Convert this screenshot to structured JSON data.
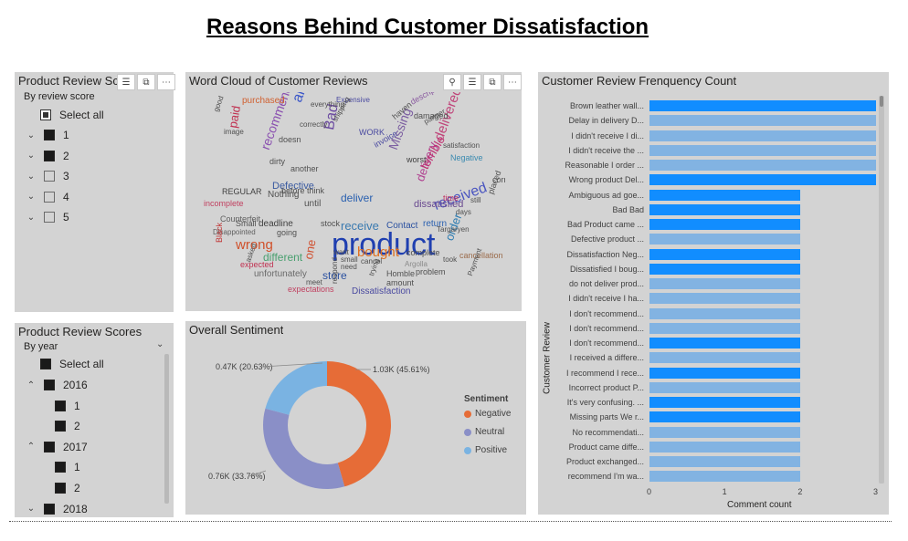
{
  "page": {
    "title": "Reasons Behind Customer Dissatisfaction"
  },
  "colors": {
    "panel_bg": "#d3d3d3",
    "bar_dark": "#118dff",
    "bar_light": "#82b3e2",
    "negative": "#e66c37",
    "neutral": "#8a8fc7",
    "positive": "#7ab3e2"
  },
  "slicer1": {
    "title": "Product Review Scores",
    "subtitle": "By review score",
    "select_all": "Select all",
    "items": [
      {
        "label": "1",
        "checked": true
      },
      {
        "label": "2",
        "checked": true
      },
      {
        "label": "3",
        "checked": false
      },
      {
        "label": "4",
        "checked": false
      },
      {
        "label": "5",
        "checked": false
      }
    ],
    "icons": [
      "filter-icon",
      "focus-mode-icon",
      "more-options-icon"
    ]
  },
  "slicer2": {
    "title": "Product Review Scores",
    "subtitle": "By year",
    "select_all": "Select all",
    "rows": [
      {
        "label": "2016",
        "level": 0,
        "expanded": true
      },
      {
        "label": "1",
        "level": 1
      },
      {
        "label": "2",
        "level": 1
      },
      {
        "label": "2017",
        "level": 0,
        "expanded": true
      },
      {
        "label": "1",
        "level": 1
      },
      {
        "label": "2",
        "level": 1
      },
      {
        "label": "2018",
        "level": 0,
        "expanded": false
      }
    ]
  },
  "wordcloud": {
    "title": "Word Cloud of Customer Reviews",
    "icons": [
      "pin-icon",
      "filter-icon",
      "focus-mode-icon",
      "more-options-icon"
    ],
    "words": [
      {
        "text": "product",
        "color": "#1f3fb0"
      },
      {
        "text": "received",
        "color": "#4a55c0"
      },
      {
        "text": "delivered",
        "color": "#c0457a"
      },
      {
        "text": "arrived",
        "color": "#3a56c8"
      },
      {
        "text": "Missing",
        "color": "#7a5ca0"
      },
      {
        "text": "bought",
        "color": "#e07020"
      },
      {
        "text": "wrong",
        "color": "#d0502a"
      },
      {
        "text": "recommend",
        "color": "#8a4fb0"
      },
      {
        "text": "delivery",
        "color": "#b04090"
      },
      {
        "text": "terrible",
        "color": "#c03070"
      },
      {
        "text": "Bad",
        "color": "#6b4aa0"
      },
      {
        "text": "receive",
        "color": "#3a7ab0"
      },
      {
        "text": "paid",
        "color": "#c03050"
      },
      {
        "text": "order",
        "color": "#2a7ab0"
      },
      {
        "text": "one",
        "color": "#d05030"
      },
      {
        "text": "different",
        "color": "#4aa070"
      },
      {
        "text": "store",
        "color": "#2a50a0"
      },
      {
        "text": "Defective",
        "color": "#3a5aa0"
      },
      {
        "text": "dissatisfied",
        "color": "#6a4a90"
      },
      {
        "text": "deliver",
        "color": "#2a60b0"
      },
      {
        "text": "unfortunately",
        "color": "#6a6a6a"
      },
      {
        "text": "Expensive",
        "color": "#4a4aa0"
      },
      {
        "text": "damaged",
        "color": "#505050"
      },
      {
        "text": "purchased",
        "color": "#d06030"
      },
      {
        "text": "cancellation",
        "color": "#9a6a4a"
      },
      {
        "text": "WORK",
        "color": "#4a4aa0"
      },
      {
        "text": "Negative",
        "color": "#3a8ab0"
      },
      {
        "text": "satisfaction",
        "color": "#505050"
      },
      {
        "text": "complete",
        "color": "#505050"
      },
      {
        "text": "Nothing",
        "color": "#505050"
      },
      {
        "text": "Counterfeit",
        "color": "#606060"
      },
      {
        "text": "Disappointed",
        "color": "#606060"
      },
      {
        "text": "incomplete",
        "color": "#c04060"
      },
      {
        "text": "deadline",
        "color": "#404040"
      },
      {
        "text": "Contact",
        "color": "#2a50a0"
      },
      {
        "text": "problem",
        "color": "#505050"
      },
      {
        "text": "Dissatisfaction",
        "color": "#4a4aa0"
      },
      {
        "text": "amount",
        "color": "#505050"
      },
      {
        "text": "REGULAR",
        "color": "#404040"
      },
      {
        "text": "Black",
        "color": "#c03030"
      },
      {
        "text": "Homble",
        "color": "#505050"
      },
      {
        "text": "expectations",
        "color": "#c04060"
      },
      {
        "text": "Argolla",
        "color": "#8a8a8a"
      },
      {
        "text": "invoice",
        "color": "#4a4aa0"
      },
      {
        "text": "description",
        "color": "#8a5aa0"
      },
      {
        "text": "everything",
        "color": "#505050"
      },
      {
        "text": "correctly",
        "color": "#505050"
      },
      {
        "text": "shipping",
        "color": "#505050"
      },
      {
        "text": "return",
        "color": "#2a60b0"
      },
      {
        "text": "haven",
        "color": "#505050"
      },
      {
        "text": "partner",
        "color": "#505050"
      },
      {
        "text": "worst",
        "color": "#404040"
      },
      {
        "text": "time",
        "color": "#c03060"
      },
      {
        "text": "days",
        "color": "#505050"
      },
      {
        "text": "still",
        "color": "#505050"
      },
      {
        "text": "placed",
        "color": "#505050"
      },
      {
        "text": "correct",
        "color": "#505050"
      },
      {
        "text": "good",
        "color": "#505050"
      },
      {
        "text": "image",
        "color": "#505050"
      },
      {
        "text": "doesn",
        "color": "#505050"
      },
      {
        "text": "meet",
        "color": "#505050"
      },
      {
        "text": "small",
        "color": "#505050"
      },
      {
        "text": "cancel",
        "color": "#505050"
      },
      {
        "text": "need",
        "color": "#505050"
      },
      {
        "text": "want",
        "color": "#505050"
      },
      {
        "text": "asked",
        "color": "#505050"
      },
      {
        "text": "Payment",
        "color": "#505050"
      },
      {
        "text": "trying",
        "color": "#505050"
      },
      {
        "text": "respond",
        "color": "#505050"
      },
      {
        "text": "took",
        "color": "#505050"
      },
      {
        "text": "another",
        "color": "#505050"
      },
      {
        "text": "dirty",
        "color": "#505050"
      },
      {
        "text": "going",
        "color": "#505050"
      },
      {
        "text": "until",
        "color": "#505050"
      },
      {
        "text": "stock",
        "color": "#505050"
      },
      {
        "text": "Targaryen",
        "color": "#505050"
      },
      {
        "text": "expected",
        "color": "#c03050"
      },
      {
        "text": "before think",
        "color": "#505050"
      },
      {
        "text": "Small",
        "color": "#505050"
      }
    ]
  },
  "donut": {
    "title": "Overall Sentiment",
    "legend_title": "Sentiment",
    "segments": [
      {
        "name": "Negative",
        "value": 1.03,
        "label": "1.03K (45.61%)",
        "percent": 45.61,
        "color": "#e66c37"
      },
      {
        "name": "Neutral",
        "value": 0.76,
        "label": "0.76K (33.76%)",
        "percent": 33.76,
        "color": "#8a8fc7"
      },
      {
        "name": "Positive",
        "value": 0.47,
        "label": "0.47K (20.63%)",
        "percent": 20.63,
        "color": "#7ab3e2"
      }
    ]
  },
  "barchart": {
    "title": "Customer Review Frenquency Count",
    "ylabel": "Customer Review",
    "xlabel": "Comment count"
  },
  "chart_data": {
    "type": "bar",
    "orientation": "horizontal",
    "title": "Customer Review Frenquency Count",
    "xlabel": "Comment count",
    "ylabel": "Customer Review",
    "xlim": [
      0,
      3
    ],
    "xticks": [
      "0",
      "1",
      "2",
      "3"
    ],
    "categories": [
      "Brown leather wall...",
      "Delay in delivery D...",
      "I didn't receive I di...",
      "I didn't receive the ...",
      "Reasonable I order ...",
      "Wrong product Del...",
      "Ambiguous ad goe...",
      "Bad Bad",
      "Bad Product came ...",
      "Defective product ...",
      "Dissatisfaction Neg...",
      "Dissatisfied I boug...",
      "do not deliver prod...",
      "I didn't receive I ha...",
      "I don't recommend...",
      "I don't recommend...",
      "I don't recommend...",
      "I received a differe...",
      "I recommend I rece...",
      "Incorrect product P...",
      "It's very confusing. ...",
      "Missing parts We r...",
      "No recommendati...",
      "Product came diffe...",
      "Product exchanged...",
      "recommend I'm wa..."
    ],
    "values": [
      3,
      3,
      3,
      3,
      3,
      3,
      2,
      2,
      2,
      2,
      2,
      2,
      2,
      2,
      2,
      2,
      2,
      2,
      2,
      2,
      2,
      2,
      2,
      2,
      2,
      2
    ],
    "highlighted": [
      true,
      false,
      false,
      false,
      false,
      true,
      true,
      true,
      true,
      false,
      true,
      true,
      false,
      false,
      false,
      false,
      true,
      false,
      true,
      false,
      true,
      true,
      false,
      false,
      false,
      false
    ]
  }
}
